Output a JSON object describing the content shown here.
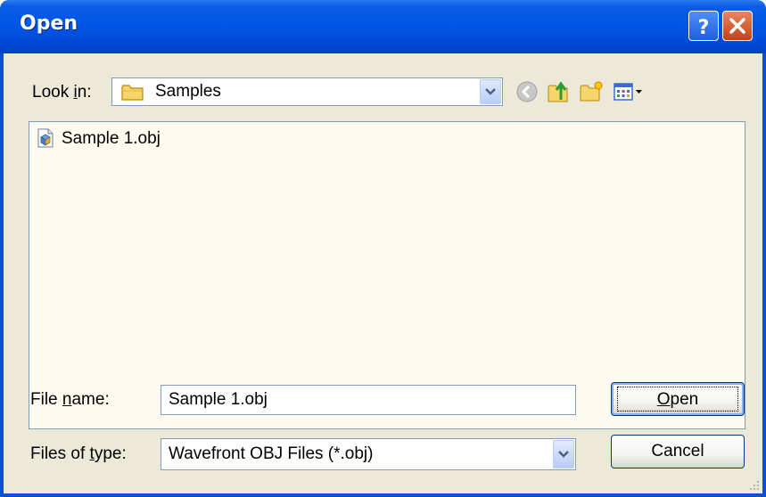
{
  "window": {
    "title": "Open"
  },
  "title_buttons": {
    "help_icon": "question-mark-icon",
    "close_icon": "close-x-icon"
  },
  "look_in": {
    "label_pre": "Look ",
    "label_accel": "i",
    "label_post": "n:",
    "value": "Samples",
    "folder_icon": "folder-icon"
  },
  "toolbar": {
    "icons": [
      "back-arrow-icon",
      "up-folder-icon",
      "new-folder-icon",
      "view-menu-icon"
    ]
  },
  "file_list": {
    "items": [
      {
        "name": "Sample 1.obj",
        "icon": "obj-file-icon"
      }
    ]
  },
  "file_name": {
    "label_pre": "File ",
    "label_accel": "n",
    "label_post": "ame:",
    "value": "Sample 1.obj"
  },
  "file_type": {
    "label_pre": "Files of ",
    "label_accel": "t",
    "label_post": "ype:",
    "value": "Wavefront OBJ Files (*.obj)"
  },
  "buttons": {
    "open_accel": "O",
    "open_rest": "pen",
    "cancel": "Cancel"
  },
  "colors": {
    "titlebar": "#0055e5",
    "dialog_bg": "#ece9d8",
    "list_bg": "#fffbf0",
    "field_border": "#7f9db9",
    "close_button": "#c4421a"
  }
}
